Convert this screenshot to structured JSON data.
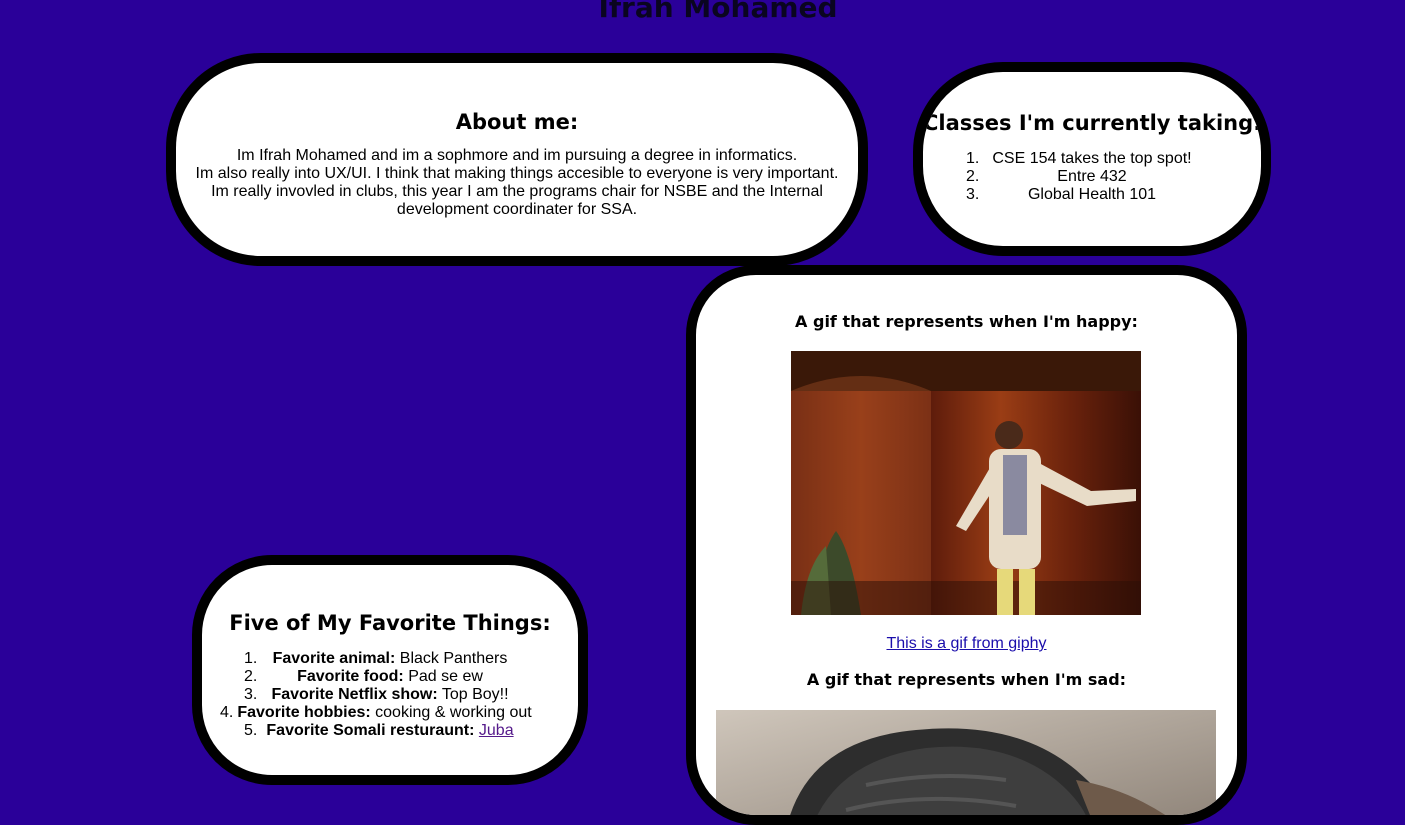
{
  "page": {
    "title": "Ifrah Mohamed",
    "background_color": "#2a0099"
  },
  "about": {
    "heading": "About me:",
    "lines": [
      "Im Ifrah Mohamed and im a sophmore and im pursuing a degree in informatics.",
      "Im also really into UX/UI. I think that making things accesible to everyone is very important.",
      "Im really invovled in clubs, this year I am the programs chair for NSBE and the Internal",
      "development coordinater for SSA."
    ]
  },
  "classes": {
    "heading": "Classes I'm currently taking:",
    "items": [
      {
        "num": "1.",
        "text": "CSE 154 takes the top spot!"
      },
      {
        "num": "2.",
        "text": "Entre 432"
      },
      {
        "num": "3.",
        "text": "Global Health 101"
      }
    ]
  },
  "favorites": {
    "heading": "Five of My Favorite Things:",
    "items": [
      {
        "num": "1.",
        "label": "Favorite animal:",
        "value": "Black Panthers"
      },
      {
        "num": "2.",
        "label": "Favorite food:",
        "value": "Pad se ew"
      },
      {
        "num": "3.",
        "label": "Favorite Netflix show:",
        "value": "Top Boy!!"
      },
      {
        "num": "4.",
        "label": "Favorite hobbies:",
        "value": "cooking & working out"
      },
      {
        "num": "5.",
        "label": "Favorite Somali resturaunt:",
        "value": "",
        "link": "Juba"
      }
    ]
  },
  "gifs": {
    "happy_heading": "A gif that represents when I'm happy:",
    "happy_image": "dancing man in cardigan gif",
    "link_text": "This is a gif from giphy",
    "sad_heading": "A gif that represents when I'm sad:",
    "sad_image": "man in beanie lying down gif"
  }
}
